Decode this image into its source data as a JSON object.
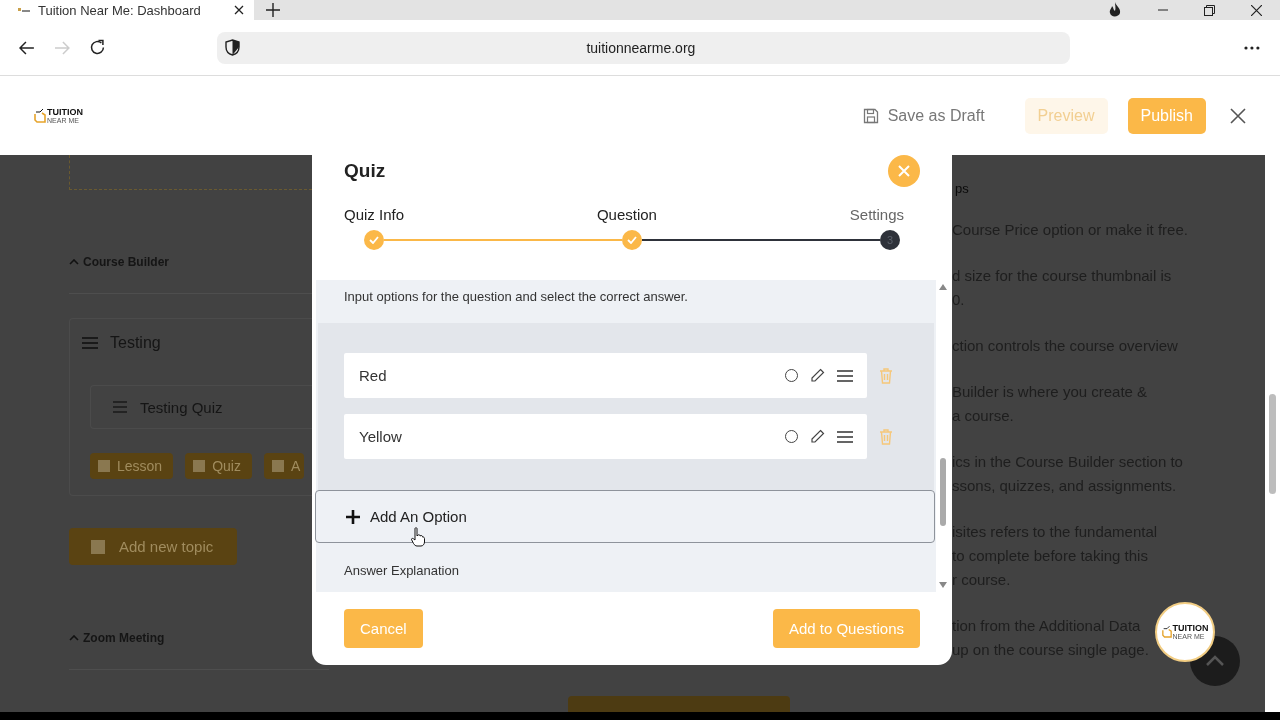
{
  "browser": {
    "tab_title": "Tuition Near Me: Dashboard",
    "url": "tuitionnearme.org"
  },
  "header": {
    "logo": {
      "name": "TUITION",
      "tagline": "NEAR ME"
    },
    "save_draft": "Save as Draft",
    "buttons": [
      {
        "label": "Preview",
        "disabled": true
      },
      {
        "label": "Publish",
        "disabled": false
      }
    ]
  },
  "builder": {
    "course_builder": "Course Builder",
    "topic": {
      "title": "Testing",
      "items": [
        "Testing Quiz"
      ],
      "buttons": [
        "Lesson",
        "Quiz",
        "A"
      ]
    },
    "add_topic": "Add new topic",
    "zoom_meeting": "Zoom Meeting"
  },
  "tips": {
    "heading": "ps",
    "paragraphs": [
      [
        "Course Price option or make it free."
      ],
      [
        "d size for the course thumbnail is",
        "0."
      ],
      [
        "ction controls the course overview"
      ],
      [
        "Builder is where you create &",
        "a course."
      ],
      [
        "ics in the Course Builder section to",
        "ssons, quizzes, and assignments."
      ],
      [
        "isites refers to the fundamental",
        "to complete before taking this",
        "r course."
      ],
      [
        "tion from the Additional Data",
        "up on the course single page."
      ]
    ]
  },
  "floating_logo": {
    "name": "TUITION",
    "tagline": "NEAR ME"
  },
  "modal": {
    "title": "Quiz",
    "steps": [
      {
        "label": "Quiz Info",
        "completed": true
      },
      {
        "label": "Question",
        "completed": true
      },
      {
        "label": "Settings",
        "number": "3",
        "completed": false
      }
    ],
    "instruction": "Input options for the question and select the correct answer.",
    "options": [
      {
        "text": "Red",
        "selected": false
      },
      {
        "text": "Yellow",
        "selected": false
      }
    ],
    "add_option": "Add An Option",
    "answer_explanation": "Answer Explanation",
    "cancel": "Cancel",
    "submit": "Add to Questions"
  }
}
